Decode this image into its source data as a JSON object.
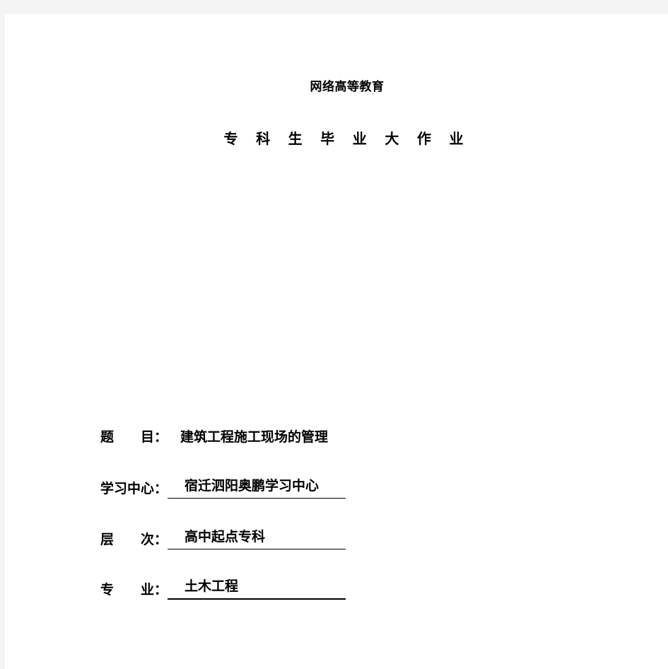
{
  "document": {
    "heading_top": "网络高等教育",
    "heading_main": "专 科 生 毕 业 大 作 业",
    "fields": {
      "title": {
        "label": "题　　目：",
        "value": "建筑工程施工现场的管理"
      },
      "study_center": {
        "label": "学习中心：",
        "value": "宿迁泗阳奥鹏学习中心"
      },
      "level": {
        "label": "层　　次：",
        "value": "高中起点专科"
      },
      "major": {
        "label": "专　　业：",
        "value": "土木工程"
      }
    }
  },
  "colors": {
    "page_background": "#ffffff",
    "backdrop": "#f4f4f4",
    "text": "#000000",
    "rule": "#000000"
  }
}
